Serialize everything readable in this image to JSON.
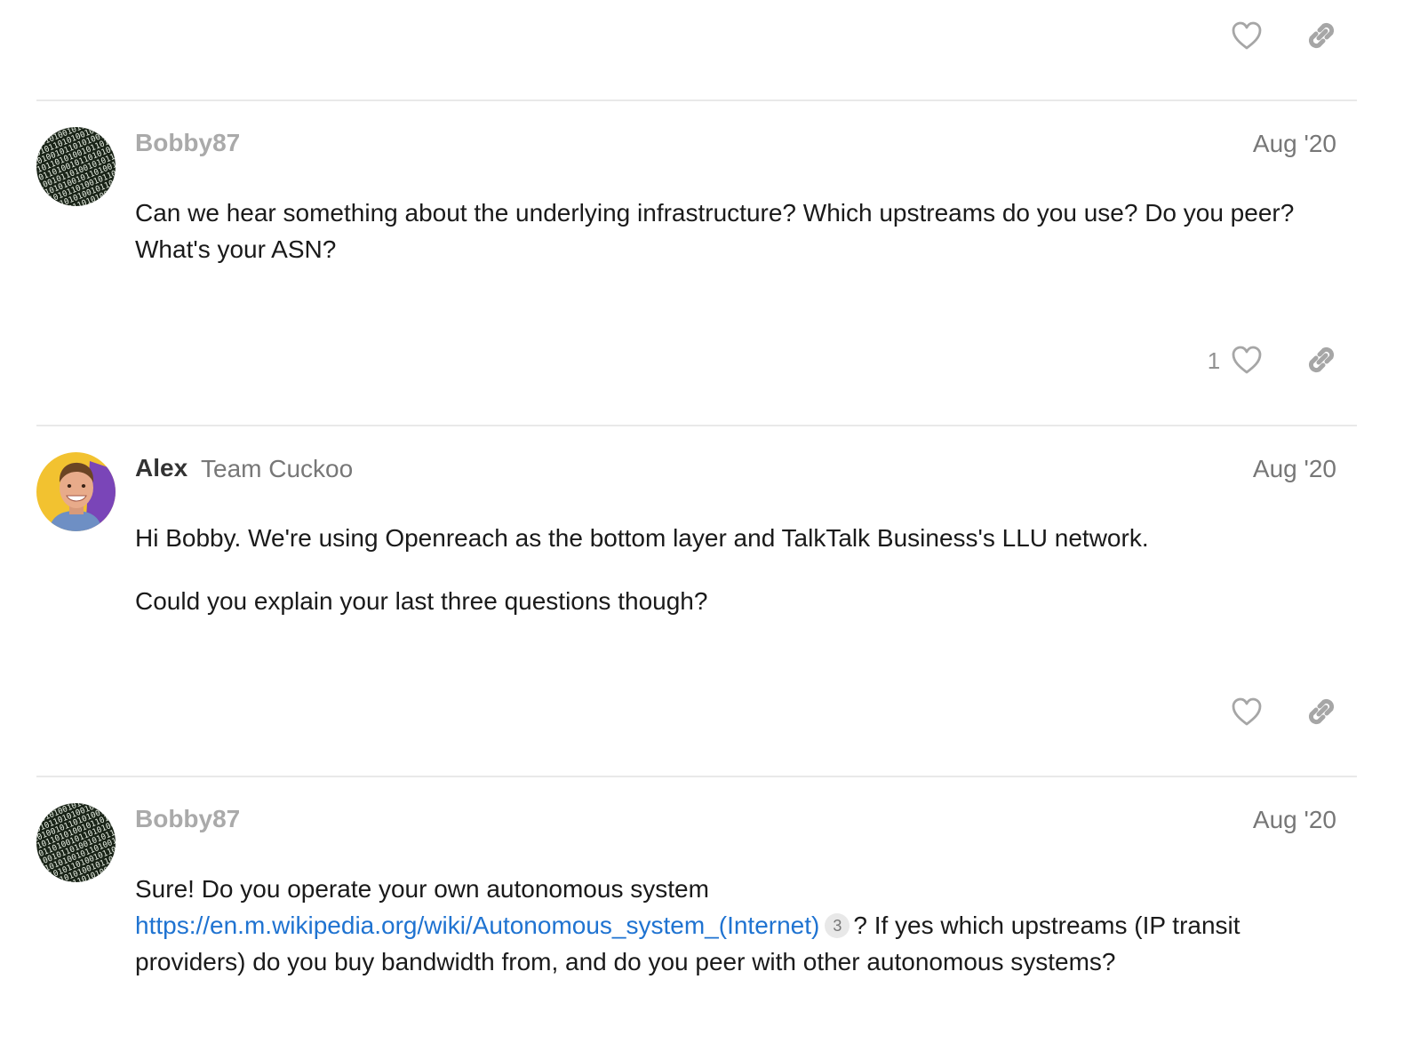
{
  "top_actions": {
    "like_icon": "heart-icon",
    "link_icon": "link-icon"
  },
  "posts": [
    {
      "username": "Bobby87",
      "date": "Aug '20",
      "avatar": "binary-code-avatar",
      "paragraphs": [
        "Can we hear something about the underlying infrastructure? Which upstreams do you use? Do you peer? What's your ASN?"
      ],
      "like_count": "1"
    },
    {
      "username": "Alex",
      "user_title": "Team Cuckoo",
      "date": "Aug '20",
      "avatar": "person-photo-avatar",
      "paragraphs": [
        "Hi Bobby. We're using Openreach as the bottom layer and TalkTalk Business's LLU network.",
        "Could you explain your last three questions though?"
      ],
      "like_count": ""
    },
    {
      "username": "Bobby87",
      "date": "Aug '20",
      "avatar": "binary-code-avatar",
      "body_before_link": "Sure! Do you operate your own autonomous system",
      "link_text": "https://en.m.wikipedia.org/wiki/Autonomous_system_(Internet)",
      "link_click_count": "3",
      "body_after_link": "? If yes which upstreams (IP transit providers) do you buy bandwidth from, and do you peer with other autonomous systems?"
    }
  ],
  "colors": {
    "link": "#1f73d1",
    "username_muted": "#aaaaaa",
    "username_staff": "#333333",
    "meta": "#777777",
    "divider": "#e9e9e9",
    "avatar_alex_bg": "#f2c230"
  }
}
